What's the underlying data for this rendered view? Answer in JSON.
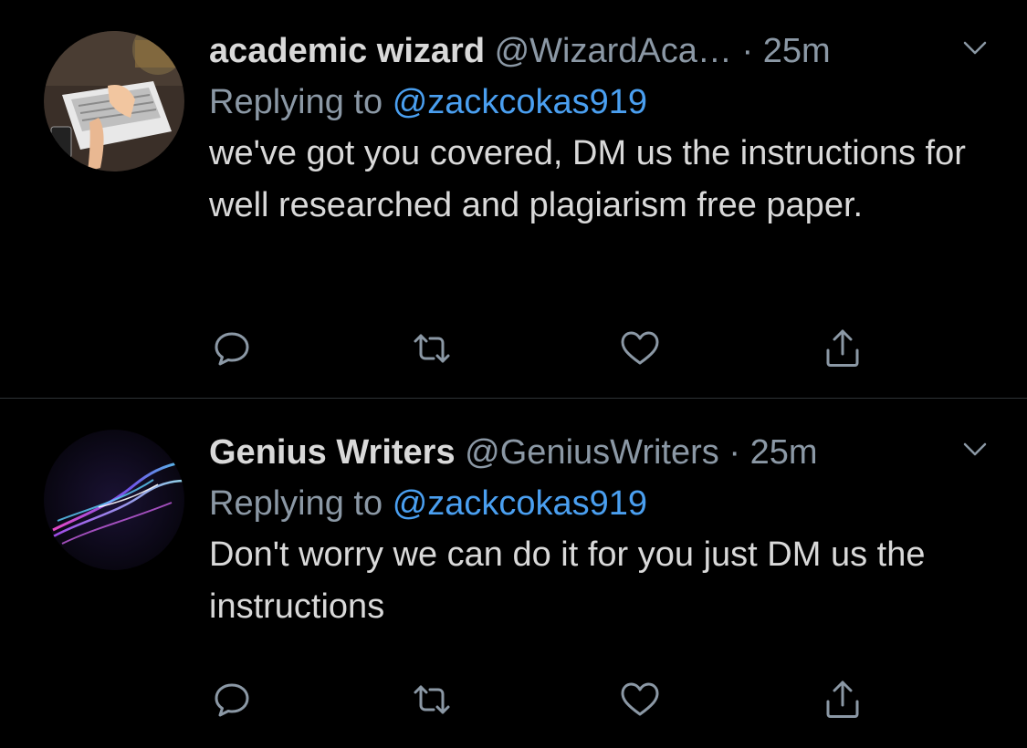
{
  "theme": {
    "background": "#000000",
    "text_primary": "#d9d9d9",
    "text_secondary": "#8b98a5",
    "link": "#4a9ff0",
    "divider": "#2f3336"
  },
  "tweets": [
    {
      "avatar_icon": "laptop-typing-photo",
      "display_name": "academic wizard",
      "handle": "@WizardAca…",
      "separator": "·",
      "time": "25m",
      "reply_prefix": "Replying to",
      "reply_handle": "@zackcokas919",
      "text": "we've got you covered, DM us the instructions for well researched and plagiarism free paper.",
      "actions": [
        "reply-icon",
        "retweet-icon",
        "like-icon",
        "share-icon"
      ]
    },
    {
      "avatar_icon": "light-streaks-logo",
      "display_name": "Genius Writers",
      "handle": "@GeniusWriters",
      "separator": "·",
      "time": "25m",
      "reply_prefix": "Replying to",
      "reply_handle": "@zackcokas919",
      "text": "Don't worry we can do it for you just DM us the instructions",
      "actions": [
        "reply-icon",
        "retweet-icon",
        "like-icon",
        "share-icon"
      ]
    }
  ]
}
